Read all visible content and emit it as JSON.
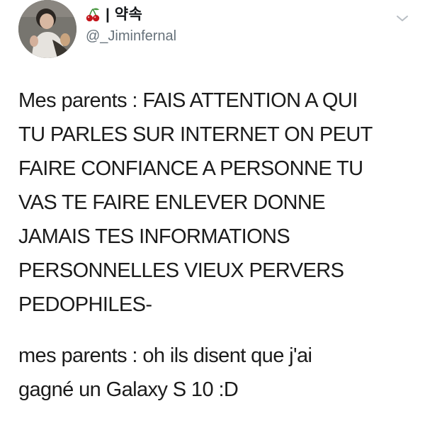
{
  "user": {
    "display_name": "| 약속",
    "handle": "@_Jiminfernal",
    "avatar_icon": "profile-photo",
    "name_emoji_icon": "cherry-icon",
    "menu_icon": "chevron-down-icon"
  },
  "tweet": {
    "paragraphs": [
      "Mes parents : FAIS ATTENTION A QUI\nTU PARLES SUR INTERNET ON PEUT\nFAIRE CONFIANCE A PERSONNE TU\nVAS TE FAIRE ENLEVER DONNE\nJAMAIS TES INFORMATIONS\nPERSONNELLES VIEUX PERVERS\nPEDOPHILES-",
      "mes parents : oh ils disent que j'ai\ngagné un Galaxy S 10 :D"
    ]
  },
  "colors": {
    "text": "#1b1b1b",
    "handle": "#66717a",
    "chevron": "#b8bec4",
    "cherry_red": "#c4161c",
    "cherry_stem": "#3e8b3a"
  }
}
